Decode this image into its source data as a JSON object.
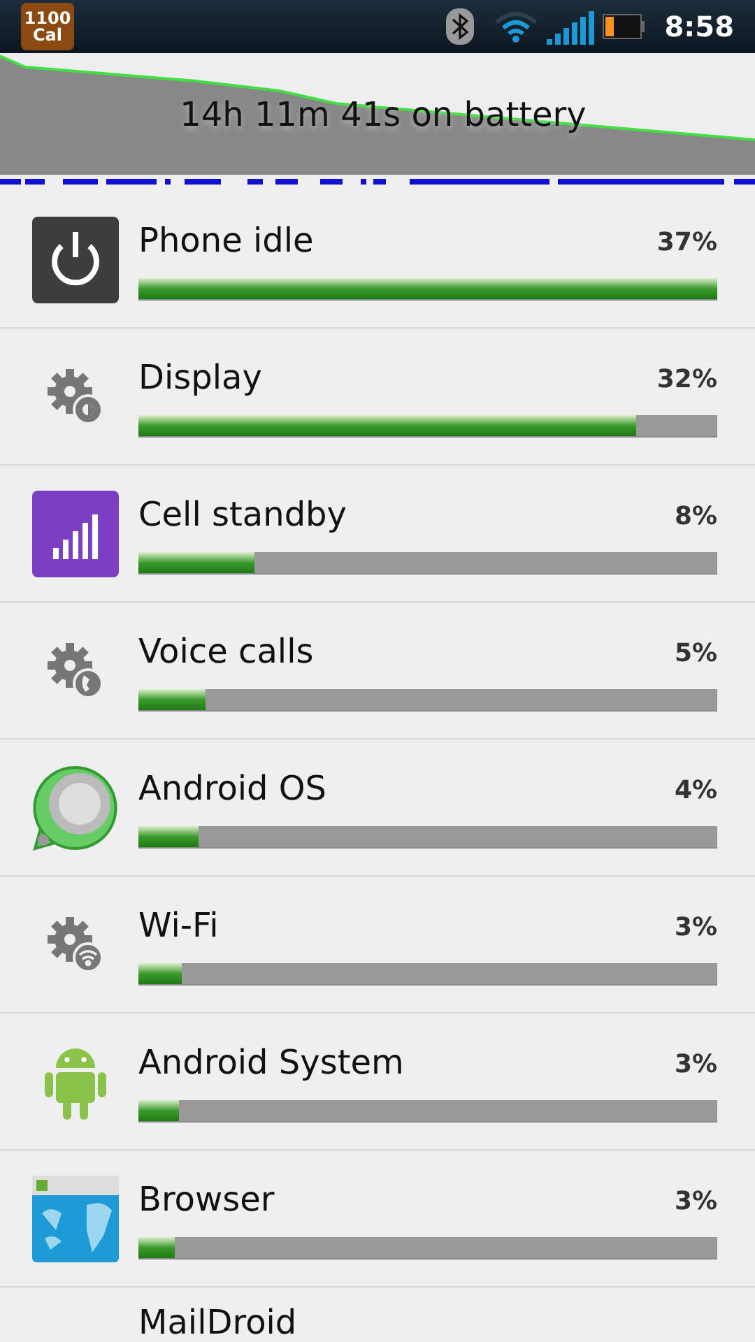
{
  "status_bar": {
    "notification": {
      "line_1": "1100",
      "line_2": "Cal"
    },
    "time": "8:58"
  },
  "history": {
    "caption": "14h 11m 41s on battery"
  },
  "usage": [
    {
      "name": "Phone idle",
      "percent": "37%",
      "level": 1.0,
      "kind": "power"
    },
    {
      "name": "Display",
      "percent": "32%",
      "level": 0.86,
      "kind": "gear-display"
    },
    {
      "name": "Cell standby",
      "percent": "8%",
      "level": 0.2,
      "kind": "signal"
    },
    {
      "name": "Voice calls",
      "percent": "5%",
      "level": 0.116,
      "kind": "gear-phone"
    },
    {
      "name": "Android OS",
      "percent": "4%",
      "level": 0.104,
      "kind": "sphere"
    },
    {
      "name": "Wi-Fi",
      "percent": "3%",
      "level": 0.075,
      "kind": "gear-wifi"
    },
    {
      "name": "Android System",
      "percent": "3%",
      "level": 0.07,
      "kind": "robot"
    },
    {
      "name": "Browser",
      "percent": "3%",
      "level": 0.063,
      "kind": "browser"
    }
  ],
  "partial_row": {
    "name": "MailDroid"
  }
}
